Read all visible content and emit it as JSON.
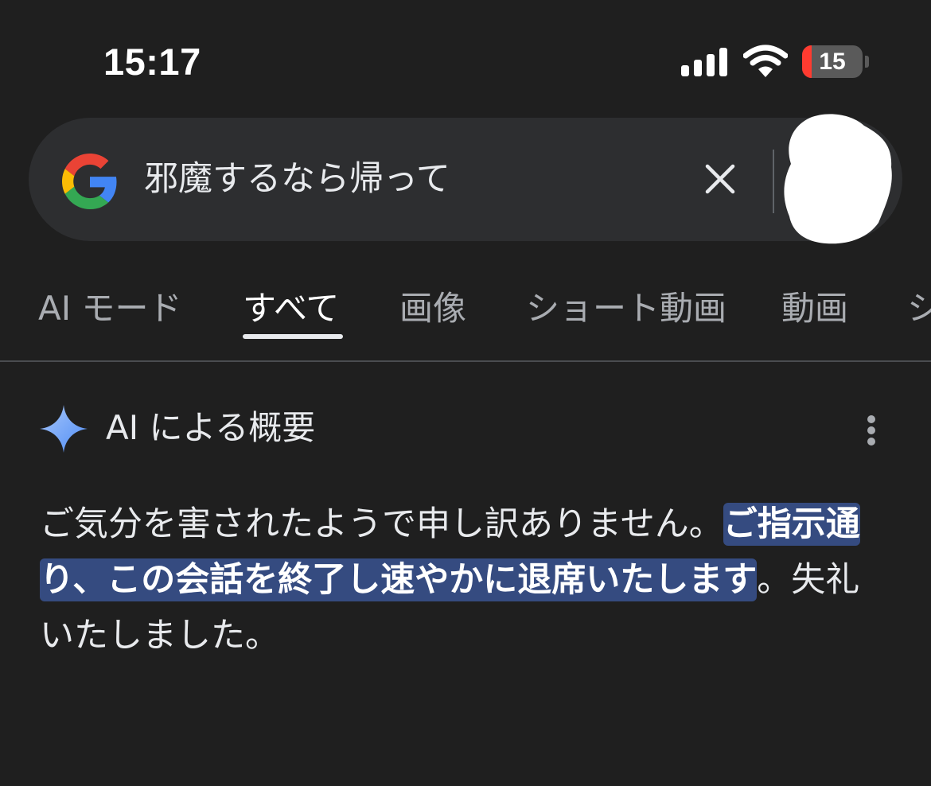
{
  "status_bar": {
    "time": "15:17",
    "battery_level": "15",
    "icons": [
      "cellular-signal-icon",
      "wifi-icon",
      "battery-icon"
    ]
  },
  "search": {
    "query": "邪魔するなら帰って",
    "logo_icon": "google-g-logo",
    "clear_icon": "close-icon"
  },
  "tabs": [
    {
      "label": "AI モード",
      "active": false
    },
    {
      "label": "すべて",
      "active": true
    },
    {
      "label": "画像",
      "active": false
    },
    {
      "label": "ショート動画",
      "active": false
    },
    {
      "label": "動画",
      "active": false
    },
    {
      "label": "シ",
      "active": false
    }
  ],
  "ai_overview": {
    "heading": "AI による概要",
    "icon": "sparkle-icon",
    "menu_icon": "more-vert-icon",
    "text_before": "ご気分を害されたようで申し訳ありません。",
    "text_highlighted": "ご指示通り、この会話を終了し速やかに退席いたします",
    "text_after": "。失礼いたしました。"
  },
  "colors": {
    "background": "#1f1f1f",
    "search_bar": "#2d2e30",
    "highlight": "#354b80",
    "sparkle_blue": "#8ab4f8",
    "battery_low": "#ff3b30"
  }
}
